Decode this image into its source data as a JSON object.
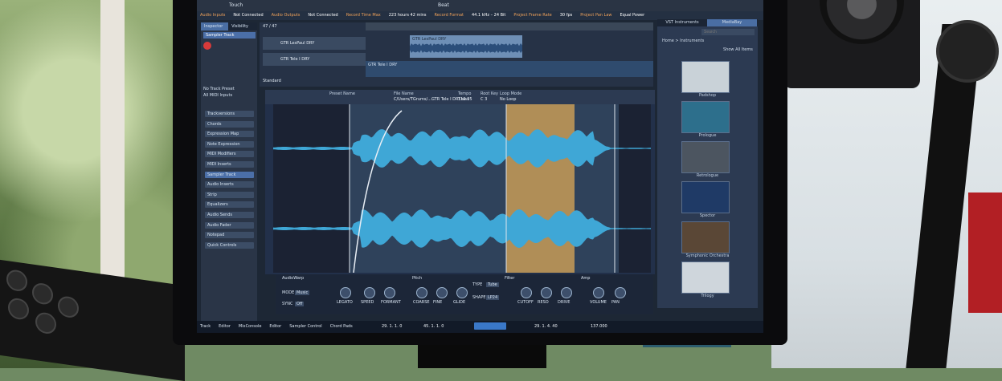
{
  "scene": {
    "description_colors": {
      "foliage": "#7fa05e",
      "wall": "#e4e8ea",
      "monitor_bezel": "#0b0b0d",
      "accent_gold": "#b08e57",
      "waveform_blue": "#3fa7d6"
    }
  },
  "daw": {
    "info_bar": [
      "Audio Inputs",
      "Not Connected",
      "Audio Outputs",
      "Not Connected",
      "Record Time Max",
      "223 hours 42 mins",
      "Record Format",
      "44.1 kHz – 24 Bit",
      "Project Frame Rate",
      "30 fps",
      "Project Pan Law",
      "Equal Power"
    ],
    "toolbar_touch_label": "Touch",
    "toolbar_beat_label": "Beat",
    "inspector": {
      "tabs": [
        "Inspector",
        "Visibility"
      ],
      "track_name": "Sampler Track",
      "preset_lines": [
        "No Track Preset",
        "All MIDI Inputs"
      ],
      "sections": [
        "Trackversions",
        "Chords",
        "Expression Map",
        "Note Expression",
        "MIDI Modifiers",
        "MIDI Inserts",
        "Sampler Track",
        "Audio Inserts",
        "Strip",
        "Equalizers",
        "Audio Sends",
        "Audio Fader",
        "Notepad",
        "Quick Controls"
      ]
    },
    "tracks": {
      "counter": "47 / 47",
      "rows": [
        "GTR LesPaul DRY",
        "GTR Tele I DRY"
      ],
      "label_standard": "Standard",
      "clip_labels": [
        "GTR LesPaul DRY",
        "GTR Tele I DRY"
      ]
    },
    "sampler_editor": {
      "header_fields": [
        "Preset Name",
        "File Name",
        "Tempo",
        "Root Key",
        "Loop Mode"
      ],
      "file_name": "C/Users/TGrums/...GTR Tele I DRY.wav",
      "tempo": "119.35",
      "root_key": "C 3",
      "loop_mode": "No Loop"
    },
    "plugin_panel": {
      "sections": [
        "AudioWarp",
        "Pitch",
        "Filter",
        "Amp"
      ],
      "audiowarp": {
        "mode_label": "MODE",
        "mode_value": "Music",
        "sync_label": "SYNC",
        "sync_value": "Off",
        "knobs": [
          "LEGATO",
          "SPEED",
          "FORMANT"
        ]
      },
      "pitch_knobs": [
        "COARSE",
        "FINE",
        "GLIDE"
      ],
      "filter": {
        "type_label": "TYPE",
        "type_value": "Tube",
        "shape_label": "SHAPE",
        "shape_value": "LP24",
        "knobs": [
          "CUTOFF",
          "RESO",
          "DRIVE"
        ]
      },
      "amp_knobs": [
        "VOLUME",
        "PAN"
      ]
    },
    "vst_panel": {
      "tabs": [
        "VST Instruments",
        "MediaBay"
      ],
      "search_placeholder": "Search",
      "breadcrumb": "Home > Instruments",
      "show_all": "Show All Items",
      "plugins": [
        "Padshop",
        "Prologue",
        "Retrologue",
        "Spector",
        "Symphonic Orchestra",
        "Trilogy"
      ]
    },
    "bottom_bar": {
      "tabs": [
        "Track",
        "Editor",
        "MixConsole",
        "Editor",
        "Sampler Control",
        "Chord Pads"
      ],
      "position_1": "29. 1. 1. 0",
      "position_2": "45. 1. 1. 0",
      "position_3": "29. 1. 4. 40",
      "tempo": "137.000"
    }
  }
}
